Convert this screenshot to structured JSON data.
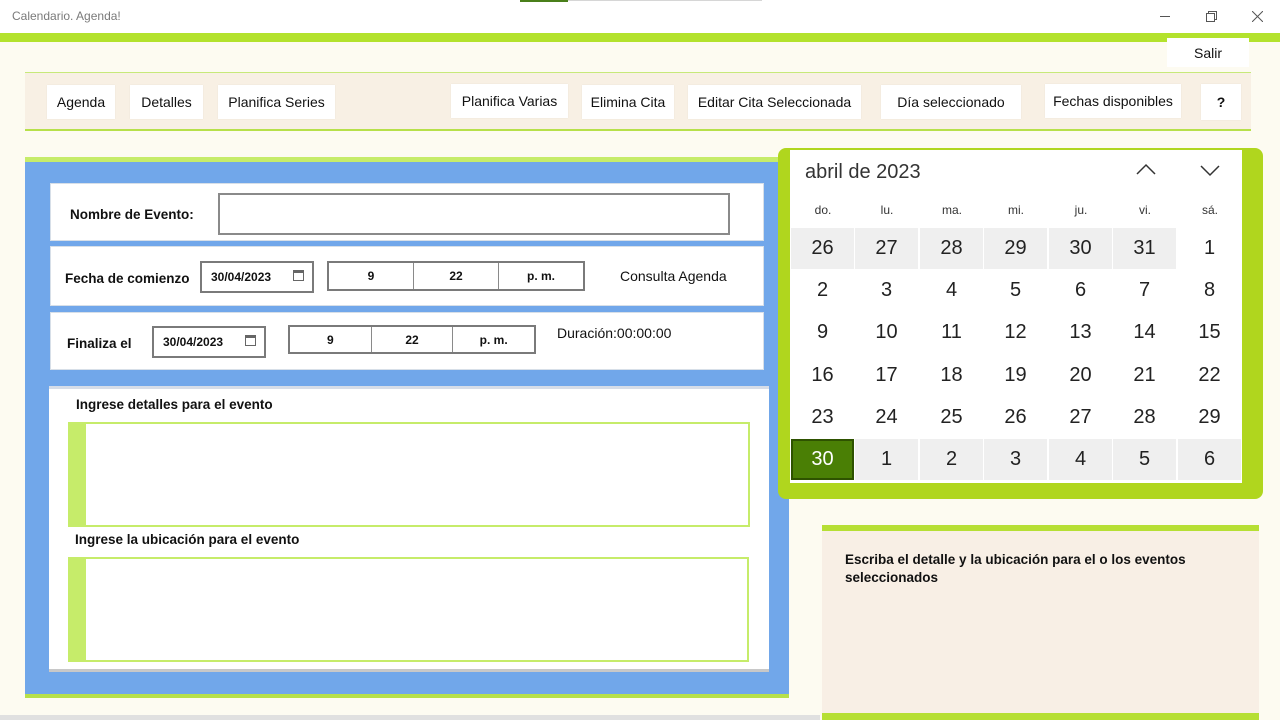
{
  "window": {
    "title": "Calendario. Agenda!"
  },
  "header": {
    "exit_label": "Salir"
  },
  "toolbar": {
    "agenda": "Agenda",
    "detalles": "Detalles",
    "planifica_series": "Planifica Series",
    "planifica_varias": "Planifica Varias",
    "elimina_cita": "Elimina Cita",
    "editar_cita": "Editar Cita Seleccionada",
    "dia_seleccionado": "Día seleccionado",
    "fechas_disponibles": "Fechas disponibles",
    "help": "?"
  },
  "form": {
    "event_name_label": "Nombre de Evento:",
    "event_name_value": "",
    "start_label": "Fecha de comienzo",
    "start_date": "30/04/2023",
    "start_hour": "9",
    "start_minute": "22",
    "start_ampm": "p. m.",
    "consulta_agenda": "Consulta Agenda",
    "end_label": "Finaliza el",
    "end_date": "30/04/2023",
    "end_hour": "9",
    "end_minute": "22",
    "end_ampm": "p. m.",
    "duration": "Duración:00:00:00",
    "details_label": "Ingrese detalles para el evento",
    "details_value": "",
    "location_label": "Ingrese la ubicación para el evento",
    "location_value": ""
  },
  "calendar": {
    "month_title": "abril de 2023",
    "weekdays": [
      "do.",
      "lu.",
      "ma.",
      "mi.",
      "ju.",
      "vi.",
      "sá."
    ],
    "weeks": [
      [
        [
          "26",
          "other"
        ],
        [
          "27",
          "other"
        ],
        [
          "28",
          "other"
        ],
        [
          "29",
          "other"
        ],
        [
          "30",
          "other"
        ],
        [
          "31",
          "other"
        ],
        [
          "1",
          "cur"
        ]
      ],
      [
        [
          "2",
          "cur"
        ],
        [
          "3",
          "cur"
        ],
        [
          "4",
          "cur"
        ],
        [
          "5",
          "cur"
        ],
        [
          "6",
          "cur"
        ],
        [
          "7",
          "cur"
        ],
        [
          "8",
          "cur"
        ]
      ],
      [
        [
          "9",
          "cur"
        ],
        [
          "10",
          "cur"
        ],
        [
          "11",
          "cur"
        ],
        [
          "12",
          "cur"
        ],
        [
          "13",
          "cur"
        ],
        [
          "14",
          "cur"
        ],
        [
          "15",
          "cur"
        ]
      ],
      [
        [
          "16",
          "cur"
        ],
        [
          "17",
          "cur"
        ],
        [
          "18",
          "cur"
        ],
        [
          "19",
          "cur"
        ],
        [
          "20",
          "cur"
        ],
        [
          "21",
          "cur"
        ],
        [
          "22",
          "cur"
        ]
      ],
      [
        [
          "23",
          "cur"
        ],
        [
          "24",
          "cur"
        ],
        [
          "25",
          "cur"
        ],
        [
          "26",
          "cur"
        ],
        [
          "27",
          "cur"
        ],
        [
          "28",
          "cur"
        ],
        [
          "29",
          "cur"
        ]
      ],
      [
        [
          "30",
          "sel"
        ],
        [
          "1",
          "other"
        ],
        [
          "2",
          "other"
        ],
        [
          "3",
          "other"
        ],
        [
          "4",
          "other"
        ],
        [
          "5",
          "other"
        ],
        [
          "6",
          "other"
        ]
      ]
    ],
    "selected_color": "#4a7f05"
  },
  "info": {
    "text": "Escriba el detalle y la ubicación para el o los eventos seleccionados"
  },
  "colors": {
    "accent": "#b3e22d",
    "panel": "#71a7ea",
    "toolbar": "#f8f0e4"
  }
}
